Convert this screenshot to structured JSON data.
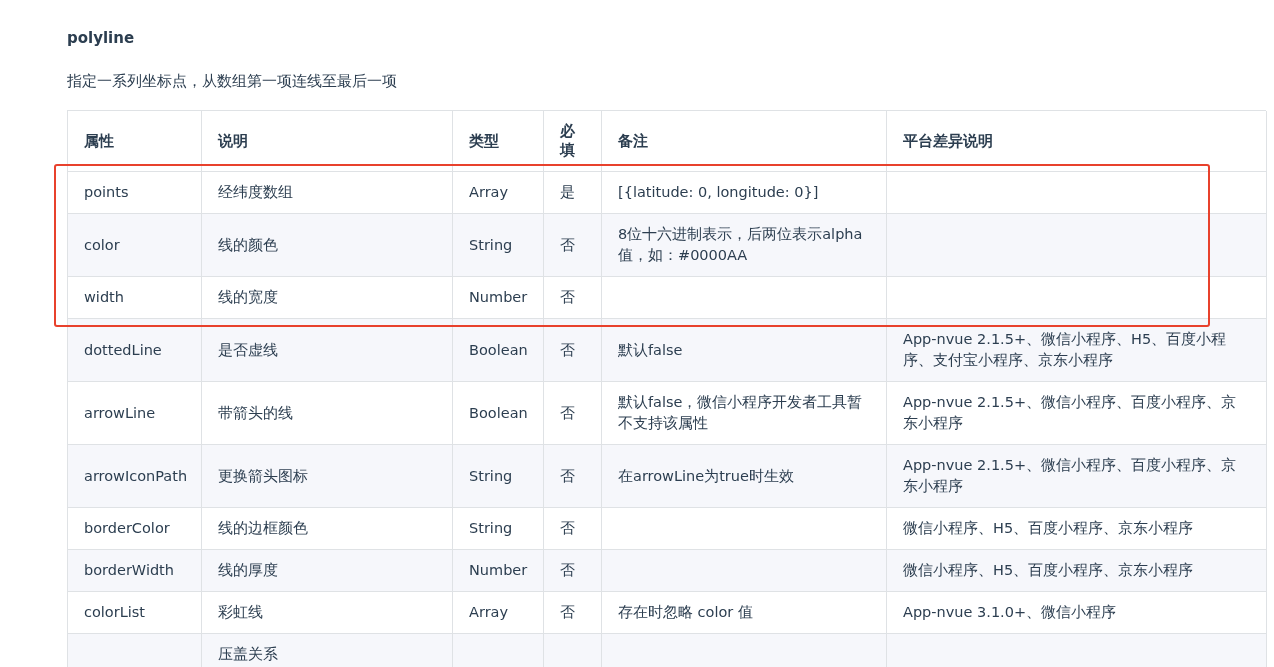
{
  "heading": "polyline",
  "description": "指定一系列坐标点，从数组第一项连线至最后一项",
  "table": {
    "columns": [
      "属性",
      "说明",
      "类型",
      "必填",
      "备注",
      "平台差异说明"
    ],
    "rows": [
      {
        "cells": [
          "points",
          "经纬度数组",
          "Array",
          "是",
          "[{latitude: 0, longitude: 0}]",
          ""
        ],
        "highlighted": true
      },
      {
        "cells": [
          "color",
          "线的颜色",
          "String",
          "否",
          "8位十六进制表示，后两位表示alpha值，如：#0000AA",
          ""
        ],
        "highlighted": true
      },
      {
        "cells": [
          "width",
          "线的宽度",
          "Number",
          "否",
          "",
          ""
        ],
        "highlighted": true
      },
      {
        "cells": [
          "dottedLine",
          "是否虚线",
          "Boolean",
          "否",
          "默认false",
          "App-nvue 2.1.5+、微信小程序、H5、百度小程序、支付宝小程序、京东小程序"
        ],
        "highlighted": false
      },
      {
        "cells": [
          "arrowLine",
          "带箭头的线",
          "Boolean",
          "否",
          "默认false，微信小程序开发者工具暂不支持该属性",
          "App-nvue 2.1.5+、微信小程序、百度小程序、京东小程序"
        ],
        "highlighted": false
      },
      {
        "cells": [
          "arrowIconPath",
          "更换箭头图标",
          "String",
          "否",
          "在arrowLine为true时生效",
          "App-nvue 2.1.5+、微信小程序、百度小程序、京东小程序"
        ],
        "highlighted": false
      },
      {
        "cells": [
          "borderColor",
          "线的边框颜色",
          "String",
          "否",
          "",
          "微信小程序、H5、百度小程序、京东小程序"
        ],
        "highlighted": false
      },
      {
        "cells": [
          "borderWidth",
          "线的厚度",
          "Number",
          "否",
          "",
          "微信小程序、H5、百度小程序、京东小程序"
        ],
        "highlighted": false
      },
      {
        "cells": [
          "colorList",
          "彩虹线",
          "Array",
          "否",
          "存在时忽略 color 值",
          "App-nvue 3.1.0+、微信小程序"
        ],
        "highlighted": false
      },
      {
        "cells": [
          "",
          "压盖关系",
          "",
          "",
          "",
          ""
        ],
        "highlighted": false
      }
    ]
  }
}
